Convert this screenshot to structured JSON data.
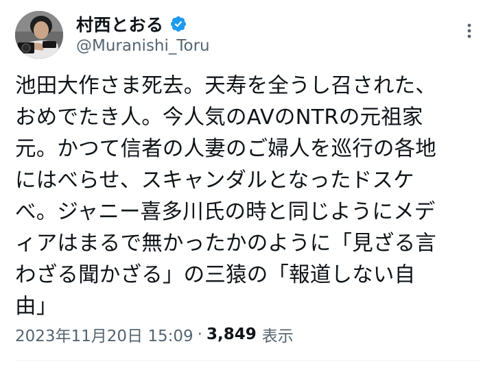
{
  "author": {
    "display_name": "村西とおる",
    "handle": "@Muranishi_Toru",
    "verified_color": "#1d9bf0",
    "avatar_icon": "profile-photo-man-with-camera"
  },
  "more_icon": "vertical-ellipsis-icon",
  "tweet": {
    "lines": [
      "池田大作さま死去。天寿を全うし召された、",
      "おめでたき人。今人気のAVのNTRの元祖家",
      "元。かつて信者の人妻のご婦人を巡行の各地",
      "にはべらせ、スキャンダルとなったドスケ",
      "べ。ジャニー喜多川氏の時と同じようにメデ",
      "ィアはまるで無かったかのように「見ざる言",
      "わざる聞かざる」の三猿の「報道しない自",
      "由」"
    ]
  },
  "meta": {
    "timestamp": "2023年11月20日 15:09",
    "separator": "·",
    "view_count": "3,849",
    "view_label": "表示"
  },
  "colors": {
    "text_primary": "#0f1419",
    "text_secondary": "#536471",
    "divider": "#eff3f4"
  }
}
